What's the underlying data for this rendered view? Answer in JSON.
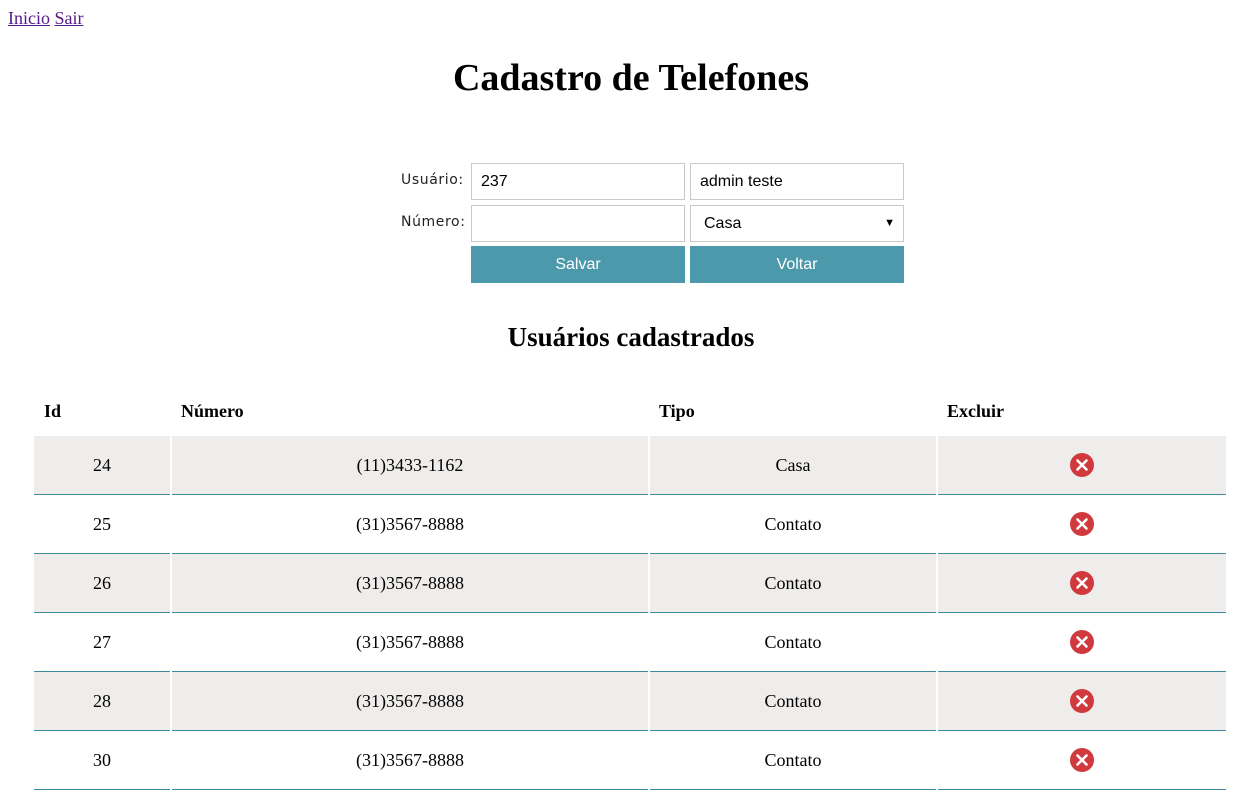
{
  "nav": {
    "home_label": "Inicio",
    "logout_label": "Sair"
  },
  "page_title": "Cadastro de Telefones",
  "form": {
    "user_label": "Usuário:",
    "user_id_value": "237",
    "user_name_value": "admin teste",
    "number_label": "Número:",
    "number_value": "",
    "type_selected": "Casa",
    "save_label": "Salvar",
    "back_label": "Voltar"
  },
  "section_title": "Usuários cadastrados",
  "table": {
    "headers": [
      "Id",
      "Número",
      "Tipo",
      "Excluir"
    ],
    "rows": [
      {
        "id": "24",
        "numero": "(11)3433-1162",
        "tipo": "Casa"
      },
      {
        "id": "25",
        "numero": "(31)3567-8888",
        "tipo": "Contato"
      },
      {
        "id": "26",
        "numero": "(31)3567-8888",
        "tipo": "Contato"
      },
      {
        "id": "27",
        "numero": "(31)3567-8888",
        "tipo": "Contato"
      },
      {
        "id": "28",
        "numero": "(31)3567-8888",
        "tipo": "Contato"
      },
      {
        "id": "30",
        "numero": "(31)3567-8888",
        "tipo": "Contato"
      }
    ]
  },
  "colors": {
    "button_bg": "#4b99ab",
    "row_alt_bg": "#efedeb",
    "row_border": "#3d8d9e",
    "delete_icon": "#d0393e",
    "link": "#551a8b"
  },
  "icons": {
    "delete": "close-circle-icon",
    "dropdown": "caret-down-icon"
  }
}
